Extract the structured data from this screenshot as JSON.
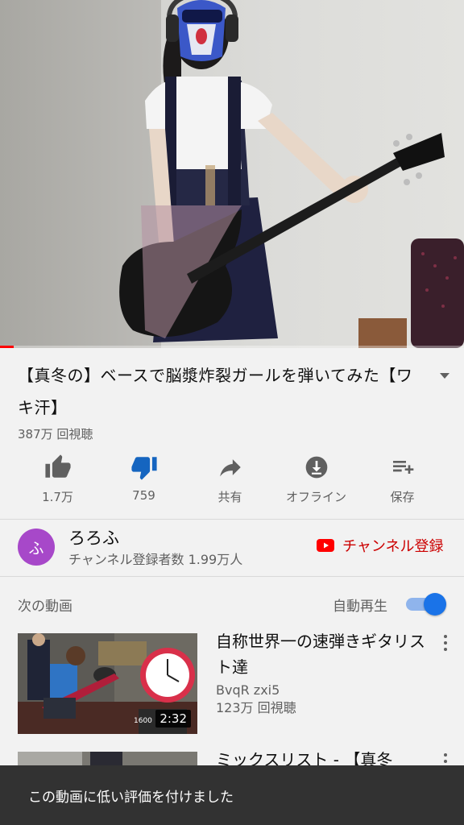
{
  "player": {
    "progress_fraction": 0.03,
    "progress_color": "#ff0000"
  },
  "video": {
    "title": "【真冬の】ベースで脳漿炸裂ガールを弾いてみた【ワキ汗】",
    "views": "387万 回視聴"
  },
  "actions": [
    {
      "icon": "thumb-up-icon",
      "label": "1.7万",
      "active": false
    },
    {
      "icon": "thumb-down-icon",
      "label": "759",
      "active": true
    },
    {
      "icon": "share-icon",
      "label": "共有",
      "active": false
    },
    {
      "icon": "download-icon",
      "label": "オフライン",
      "active": false
    },
    {
      "icon": "playlist-add-icon",
      "label": "保存",
      "active": false
    }
  ],
  "channel": {
    "avatar_letter": "ふ",
    "avatar_color": "#a748c9",
    "name": "ろろふ",
    "subscribers": "チャンネル登録者数 1.99万人",
    "subscribe_label": "チャンネル登録",
    "subscribe_color": "#cc0000"
  },
  "up_next": {
    "label": "次の動画",
    "autoplay_label": "自動再生",
    "autoplay_on": true,
    "accent": "#1a73e8"
  },
  "recommendations": [
    {
      "title": "自称世界一の速弾きギタリスト達",
      "channel": "BvqR zxi5",
      "views": "123万 回視聴",
      "duration": "2:32",
      "thumb_tag": "1600"
    },
    {
      "title": "ミックスリスト - 【真冬",
      "channel": "",
      "views": "",
      "duration": ""
    }
  ],
  "snackbar": {
    "message": "この動画に低い評価を付けました"
  }
}
